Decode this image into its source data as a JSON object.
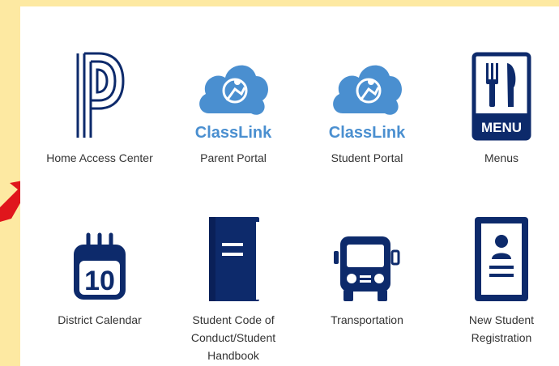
{
  "colors": {
    "background": "#fde9a2",
    "panel": "#ffffff",
    "navy": "#0d2a6b",
    "classlink_blue": "#4a8fd0",
    "arrow": "#e0161c",
    "label": "#333333"
  },
  "tiles": [
    {
      "icon": "powerschool-p-icon",
      "label": "Home Access Center"
    },
    {
      "icon": "classlink-cloud-icon",
      "label": "Parent Portal",
      "logo_text": "ClassLink"
    },
    {
      "icon": "classlink-cloud-icon",
      "label": "Student Portal",
      "logo_text": "ClassLink"
    },
    {
      "icon": "menu-fork-knife-icon",
      "label": "Menus",
      "badge_text": "MENU"
    },
    {
      "icon": "calendar-icon",
      "label": "District Calendar",
      "badge_text": "10"
    },
    {
      "icon": "book-icon",
      "label": "Student Code of Conduct/Student Handbook"
    },
    {
      "icon": "bus-icon",
      "label": "Transportation"
    },
    {
      "icon": "registration-form-icon",
      "label": "New Student Registration"
    }
  ]
}
